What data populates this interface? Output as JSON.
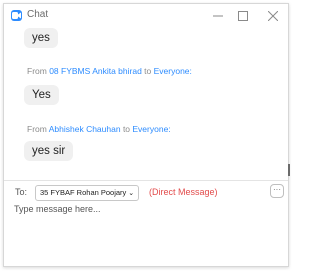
{
  "window": {
    "title": "Chat"
  },
  "messages": [
    {
      "text": "yes"
    },
    {
      "prefix": "From ",
      "sender": "08  FYBMS Ankita bhirad",
      "middle": " to ",
      "recipient": "Everyone:",
      "text": "Yes"
    },
    {
      "prefix": "From ",
      "sender": "Abhishek Chauhan",
      "middle": " to ",
      "recipient": "Everyone:",
      "text": "yes sir"
    }
  ],
  "composer": {
    "to_label": "To:",
    "recipient": "35 FYBAF Rohan Poojary",
    "chevron": "⌄",
    "direct_label": "(Direct Message)",
    "more_label": "···",
    "placeholder": "Type message here..."
  },
  "colors": {
    "accent": "#2d8cff",
    "direct": "#e24b4b",
    "bubble": "#f0f0f0"
  }
}
